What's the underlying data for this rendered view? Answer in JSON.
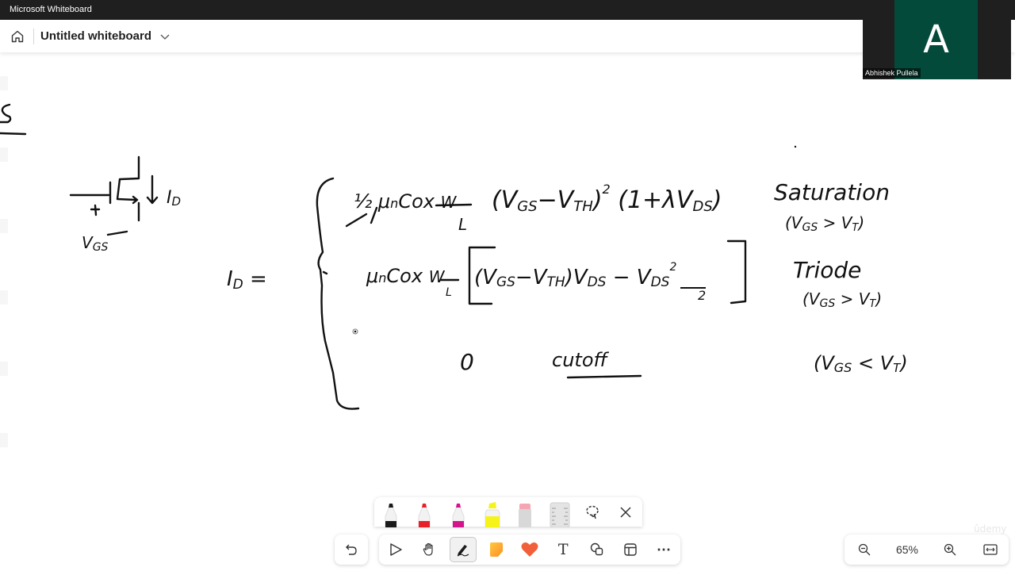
{
  "window": {
    "title": "Microsoft Whiteboard"
  },
  "appbar": {
    "board_title": "Untitled whiteboard",
    "home_icon": "home-icon",
    "title_dropdown_icon": "chevron-down-icon"
  },
  "video": {
    "initial": "A",
    "participant_name": "Abhishek Pullela",
    "tile_color": "#034a3a"
  },
  "whiteboard": {
    "ink_color": "#111111",
    "handwriting": {
      "partial_heading": "S",
      "mosfet_labels": {
        "gate_voltage": "VGS",
        "plus_sign": "+",
        "minus_sign": "—",
        "drain_current": "ID"
      },
      "lhs": "ID =",
      "cases": [
        {
          "expression": "½ μnCox W/L (VGS − VTH)² (1 + λVDS)",
          "region": "Saturation",
          "condition": "(VGS > VT)"
        },
        {
          "expression": "μnCox W/L [ (VGS − VTH) VDS − VDS²/2 ]",
          "region": "Triode",
          "condition": "(VGS > VT)"
        },
        {
          "expression": "0",
          "region": "cutoff",
          "condition": "(VGS < VT)"
        }
      ]
    }
  },
  "pen_tray": {
    "pens": [
      {
        "name": "black-pen",
        "color": "#1a1a1a"
      },
      {
        "name": "red-pen",
        "color": "#e8202a"
      },
      {
        "name": "magenta-pen",
        "color": "#d4148c"
      },
      {
        "name": "yellow-highlighter",
        "color": "#f6f31a"
      },
      {
        "name": "eraser",
        "color": "#f4a7b3"
      },
      {
        "name": "ruler",
        "color": "#d9d9d9"
      }
    ],
    "lasso_icon": "lasso-icon",
    "close_icon": "close-icon"
  },
  "toolbar": {
    "undo_icon": "undo-icon",
    "tools": [
      {
        "name": "select",
        "icon": "pointer-icon",
        "active": false
      },
      {
        "name": "pan",
        "icon": "hand-icon",
        "active": false
      },
      {
        "name": "inking",
        "icon": "pen-inking-icon",
        "active": true
      },
      {
        "name": "sticky-note",
        "icon": "sticky-note-icon",
        "active": false
      },
      {
        "name": "reactions",
        "icon": "heart-icon",
        "active": false
      },
      {
        "name": "text",
        "icon": "text-icon",
        "active": false
      },
      {
        "name": "shapes",
        "icon": "shapes-icon",
        "active": false
      },
      {
        "name": "templates",
        "icon": "template-icon",
        "active": false
      },
      {
        "name": "more",
        "icon": "more-icon",
        "active": false
      }
    ],
    "text_glyph": "T",
    "more_glyph": "⋯"
  },
  "zoom": {
    "level": "65%",
    "zoom_out_icon": "zoom-out-icon",
    "zoom_in_icon": "zoom-in-icon",
    "fit_icon": "fit-width-icon"
  },
  "watermark": "ûdemy"
}
